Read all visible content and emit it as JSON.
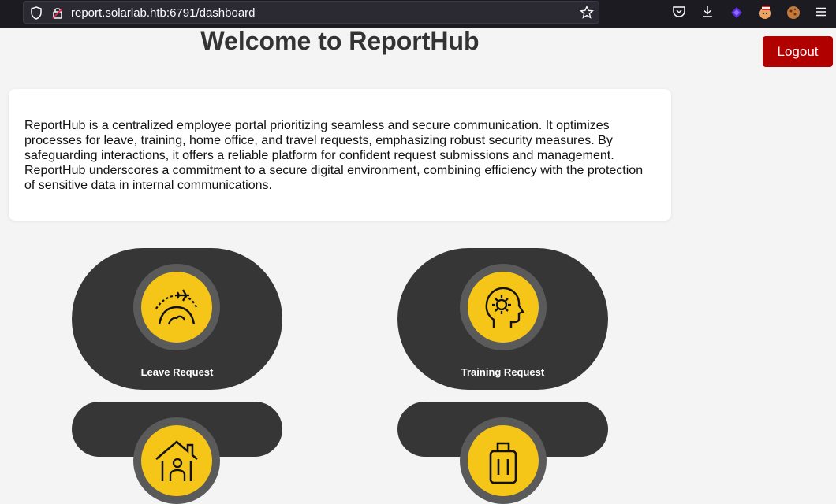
{
  "browser": {
    "url": "report.solarlab.htb:6791/dashboard"
  },
  "page": {
    "title": "Welcome to ReportHub",
    "logout_label": "Logout",
    "intro": "ReportHub is a centralized employee portal prioritizing seamless and secure communication. It optimizes processes for leave, training, home office, and travel requests, emphasizing robust security measures. By safeguarding interactions, it offers a reliable platform for confident request submissions and management. ReportHub underscores a commitment to a secure digital environment, combining efficiency with the protection of sensitive data in internal communications."
  },
  "tiles": [
    {
      "label": "Leave Request",
      "icon": "globe-airplane-icon"
    },
    {
      "label": "Training Request",
      "icon": "head-gear-icon"
    },
    {
      "label": "",
      "icon": "home-person-icon"
    },
    {
      "label": "",
      "icon": "suitcase-icon"
    }
  ],
  "colors": {
    "background": "#f4f4f4",
    "tile": "#363636",
    "icon_disc": "#f5c518",
    "logout": "#b00000"
  }
}
